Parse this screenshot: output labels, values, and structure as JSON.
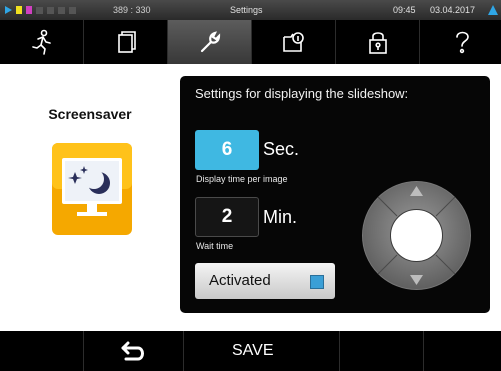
{
  "status_bar": {
    "coords": "389 : 330",
    "title": "Settings",
    "time": "09:45",
    "date": "03.04.2017"
  },
  "tabs": [
    {
      "icon": "running-person-icon",
      "active": false
    },
    {
      "icon": "documents-icon",
      "active": false
    },
    {
      "icon": "wrench-icon",
      "active": true
    },
    {
      "icon": "info-document-icon",
      "active": false
    },
    {
      "icon": "lock-icon",
      "active": false
    },
    {
      "icon": "help-icon",
      "active": false
    }
  ],
  "page": {
    "title": "Screensaver",
    "icon": "screensaver-icon"
  },
  "settings": {
    "title": "Settings for displaying the slideshow:",
    "display_time": {
      "value": "6",
      "unit": "Sec.",
      "caption": "Display time per image"
    },
    "wait_time": {
      "value": "2",
      "unit": "Min.",
      "caption": "Wait time"
    },
    "activated": {
      "label": "Activated",
      "checked": true
    }
  },
  "bottom_bar": {
    "back_icon": "back-arrow-icon",
    "save_label": "SAVE"
  },
  "colors": {
    "accent_blue": "#3fb8e2",
    "panel_bg": "#060606",
    "icon_orange": "#f5a800"
  }
}
